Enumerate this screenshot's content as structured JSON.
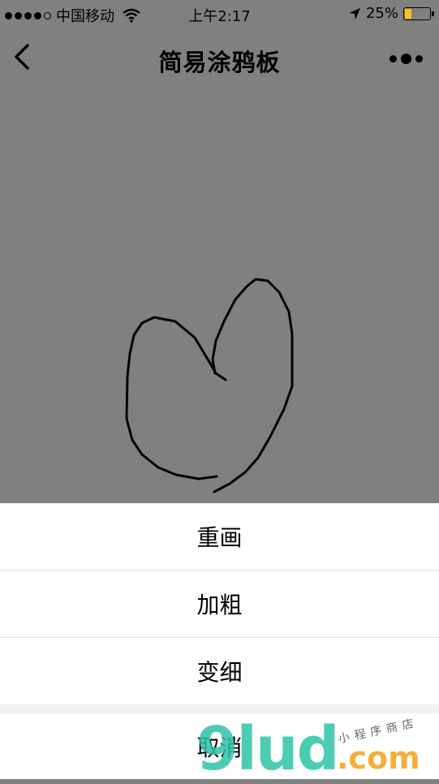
{
  "status_bar": {
    "carrier": "中国移动",
    "time": "上午2:17",
    "battery": "25%",
    "battery_level": 0.25,
    "signal_bars": 4
  },
  "nav": {
    "title": "简易涂鸦板"
  },
  "action_sheet": {
    "items": [
      {
        "label": "重画"
      },
      {
        "label": "加粗"
      },
      {
        "label": "变细"
      }
    ],
    "cancel": "取消"
  },
  "watermark": {
    "brand": "9lud",
    "tld": ".com",
    "tagline": "小程序商店"
  },
  "colors": {
    "canvas_bg": "#808080",
    "stroke": "#000000",
    "battery_fill": "#f5c518",
    "watermark_green": "#2ec4a8",
    "watermark_orange": "#f5a623"
  }
}
